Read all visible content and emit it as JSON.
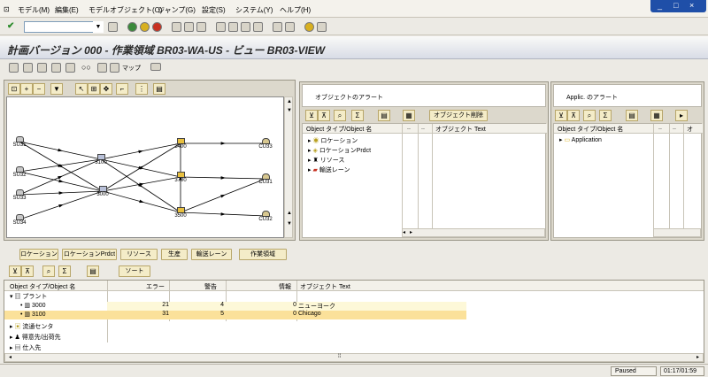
{
  "menu": {
    "items": [
      "モデル(M)",
      "編集(E)",
      "モデルオブジェクト(O)",
      "ジャンプ(G)",
      "設定(S)",
      "システム(Y)",
      "ヘルプ(H)"
    ]
  },
  "title": "計画バージョン 000 - 作業領域 BR03-WA-US - ビュー BR03-VIEW",
  "apptoolbar": {
    "map_label": "マップ"
  },
  "network": {
    "nodes": [
      {
        "id": "SU31",
        "label": "SU31"
      },
      {
        "id": "SU32",
        "label": "SU32"
      },
      {
        "id": "SU33",
        "label": "SU33"
      },
      {
        "id": "SU34",
        "label": "SU34"
      },
      {
        "id": "3100",
        "label": "3100"
      },
      {
        "id": "3000",
        "label": "3000"
      },
      {
        "id": "3400",
        "label": "3400"
      },
      {
        "id": "3700",
        "label": "3700"
      },
      {
        "id": "3500",
        "label": "3500"
      },
      {
        "id": "CU33",
        "label": "CU33"
      },
      {
        "id": "CU31",
        "label": "CU31"
      },
      {
        "id": "CU32",
        "label": "CU32"
      }
    ]
  },
  "alerts_panel": {
    "title": "オブジェクトのアラート",
    "delete_button": "オブジェクト削除",
    "col_object": "Object タイプ/Object 名",
    "col_dots1": "..",
    "col_dots2": "..",
    "col_text": "オブジェクト Text",
    "items": [
      "ロケーション",
      "ロケーションPrdct",
      "リソース",
      "輸送レーン"
    ]
  },
  "app_alerts_panel": {
    "title": "Applic. のアラート",
    "col_object": "Object タイプ/Object 名",
    "col_dots1": "..",
    "col_dots2": "..",
    "col_dots3": "オ",
    "items": [
      "Application"
    ]
  },
  "bottom_tabs": [
    "ロケーション",
    "ロケーションPrdct",
    "リソース",
    "生産",
    "輸送レーン",
    "作業領域"
  ],
  "bottom_toolbar": {
    "sort_label": "ソート"
  },
  "grid": {
    "headers": {
      "object": "Object タイプ/Object 名",
      "error": "エラー",
      "warning": "警告",
      "info": "情報",
      "text": "オブジェクト Text"
    },
    "group": "プラント",
    "rows": [
      {
        "name": "3000",
        "error": "21",
        "warning": "4",
        "info": "0",
        "text": "ニューヨーク"
      },
      {
        "name": "3100",
        "error": "31",
        "warning": "5",
        "info": "0",
        "text": "Chicago"
      }
    ],
    "other_groups": [
      "流通センタ",
      "得意先/出荷先",
      "仕入先"
    ]
  },
  "status": {
    "state": "Paused",
    "time": "01:17/01:59"
  }
}
